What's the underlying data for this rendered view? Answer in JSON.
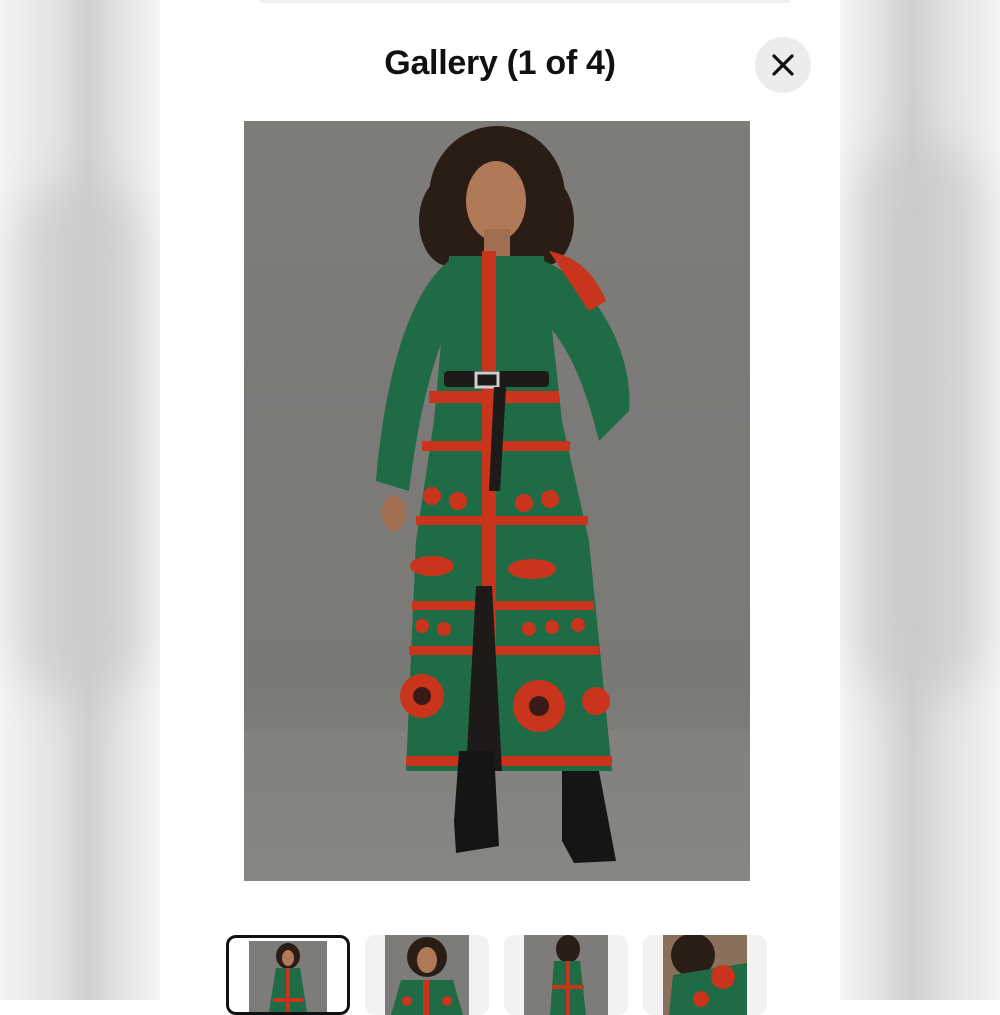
{
  "gallery": {
    "title": "Gallery (1 of 4)",
    "close_icon": "close-icon",
    "current_index": 1,
    "total": 4
  },
  "thumbnails": [
    {
      "icon": "thumbnail-1",
      "selected": true
    },
    {
      "icon": "thumbnail-2",
      "selected": false
    },
    {
      "icon": "thumbnail-3",
      "selected": false
    },
    {
      "icon": "thumbnail-4",
      "selected": false
    }
  ],
  "colors": {
    "backdrop": "#808080",
    "dress_green": "#1f6b45",
    "dress_red": "#c8341c",
    "selected_border": "#111111",
    "close_button_bg": "#ececec"
  }
}
